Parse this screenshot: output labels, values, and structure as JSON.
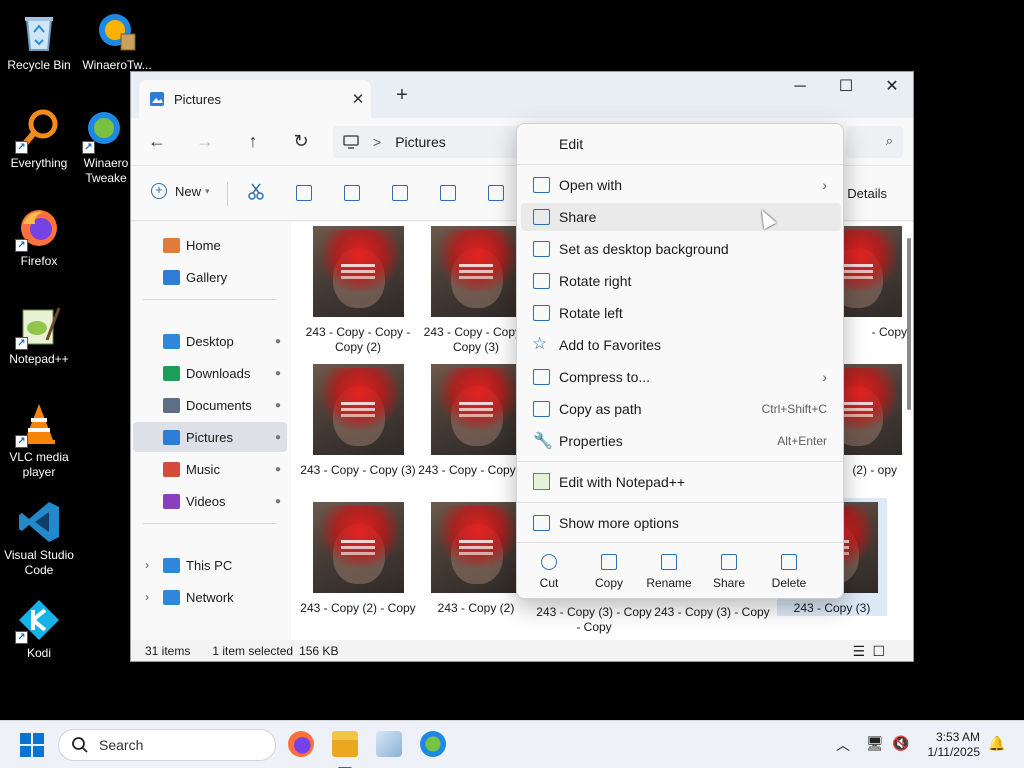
{
  "desktop": {
    "icons": [
      {
        "label": "Recycle Bin",
        "icon": "recycle-bin-icon"
      },
      {
        "label": "WinaeroTw...",
        "icon": "winaero-tweaker-icon"
      },
      {
        "label": "Everything",
        "icon": "everything-search-icon"
      },
      {
        "label": "Winaero Tweake",
        "icon": "winaero-tweaker-icon"
      },
      {
        "label": "Firefox",
        "icon": "firefox-icon"
      },
      {
        "label": "Notepad++",
        "icon": "notepadpp-icon"
      },
      {
        "label": "VLC media player",
        "icon": "vlc-icon"
      },
      {
        "label": "Visual Studio Code",
        "icon": "vscode-icon"
      },
      {
        "label": "Kodi",
        "icon": "kodi-icon"
      }
    ]
  },
  "window": {
    "tab_title": "Pictures",
    "tab_close": "✕",
    "new_tab": "+",
    "minimize": "─",
    "maximize": "☐",
    "close": "✕",
    "nav": {
      "back": "←",
      "forward": "→",
      "up": "↑",
      "refresh": "↻"
    },
    "address": {
      "separator": ">",
      "location": "Pictures"
    },
    "search_icon": "⌕",
    "toolbar": {
      "new_label": "New",
      "new_caret": "▾",
      "details_label": "Details"
    },
    "sidebar": {
      "items": [
        {
          "label": "Home",
          "pinned": false,
          "color": "#e07b39"
        },
        {
          "label": "Gallery",
          "pinned": false,
          "color": "#2f7cd6"
        },
        {
          "label": "Desktop",
          "pinned": true,
          "color": "#2e87d8"
        },
        {
          "label": "Downloads",
          "pinned": true,
          "color": "#1b9e57"
        },
        {
          "label": "Documents",
          "pinned": true,
          "color": "#5d6f86"
        },
        {
          "label": "Pictures",
          "pinned": true,
          "color": "#2f7cd6"
        },
        {
          "label": "Music",
          "pinned": true,
          "color": "#d64a3a"
        },
        {
          "label": "Videos",
          "pinned": true,
          "color": "#8a3fbf"
        },
        {
          "label": "This PC",
          "pinned": false,
          "color": "#2e87d8"
        },
        {
          "label": "Network",
          "pinned": false,
          "color": "#2e87d8"
        }
      ],
      "pin_glyph": "📌",
      "expander": "›"
    },
    "files": [
      {
        "name": "243 - Copy - Copy - Copy (2)"
      },
      {
        "name": "243 - Copy - Copy - Copy (3)"
      },
      {
        "name": "- Copy"
      },
      {
        "name": "243 - Copy - Copy (3)"
      },
      {
        "name": "243 - Copy - Copy (4)"
      },
      {
        "name": "(2) - opy"
      },
      {
        "name": "243 - Copy (2) - Copy"
      },
      {
        "name": "243 - Copy (2)"
      },
      {
        "name": "243 - Copy (3) - Copy - Copy"
      },
      {
        "name": "243 - Copy (3) - Copy"
      },
      {
        "name": "243 - Copy (3)"
      }
    ],
    "status": {
      "count": "31 items",
      "selection": "1 item selected",
      "size": "156 KB"
    }
  },
  "context_menu": {
    "header": "Edit",
    "items": [
      {
        "label": "Open with",
        "shortcut": "",
        "submenu": true,
        "icon": "open-with-icon"
      },
      {
        "label": "Share",
        "shortcut": "",
        "submenu": false,
        "icon": "share-icon"
      },
      {
        "label": "Set as desktop background",
        "shortcut": "",
        "submenu": false,
        "icon": "desktop-background-icon"
      },
      {
        "label": "Rotate right",
        "shortcut": "",
        "submenu": false,
        "icon": "rotate-right-icon"
      },
      {
        "label": "Rotate left",
        "shortcut": "",
        "submenu": false,
        "icon": "rotate-left-icon"
      },
      {
        "label": "Add to Favorites",
        "shortcut": "",
        "submenu": false,
        "icon": "star-icon"
      },
      {
        "label": "Compress to...",
        "shortcut": "",
        "submenu": true,
        "icon": "compress-icon"
      },
      {
        "label": "Copy as path",
        "shortcut": "Ctrl+Shift+C",
        "submenu": false,
        "icon": "copy-path-icon"
      },
      {
        "label": "Properties",
        "shortcut": "Alt+Enter",
        "submenu": false,
        "icon": "properties-icon"
      },
      {
        "label": "Edit with Notepad++",
        "shortcut": "",
        "submenu": false,
        "icon": "notepadpp-icon"
      },
      {
        "label": "Show more options",
        "shortcut": "",
        "submenu": false,
        "icon": "more-options-icon"
      }
    ],
    "submenu_arrow": "›",
    "actions": [
      {
        "label": "Cut",
        "icon": "cut-icon"
      },
      {
        "label": "Copy",
        "icon": "copy-icon"
      },
      {
        "label": "Rename",
        "icon": "rename-icon"
      },
      {
        "label": "Share",
        "icon": "share-icon"
      },
      {
        "label": "Delete",
        "icon": "delete-icon"
      }
    ]
  },
  "taskbar": {
    "search_placeholder": "Search",
    "time": "3:53 AM",
    "date": "1/11/2025",
    "apps": [
      "firefox-icon",
      "file-explorer-icon",
      "paint-icon",
      "winaero-tweaker-icon"
    ]
  }
}
